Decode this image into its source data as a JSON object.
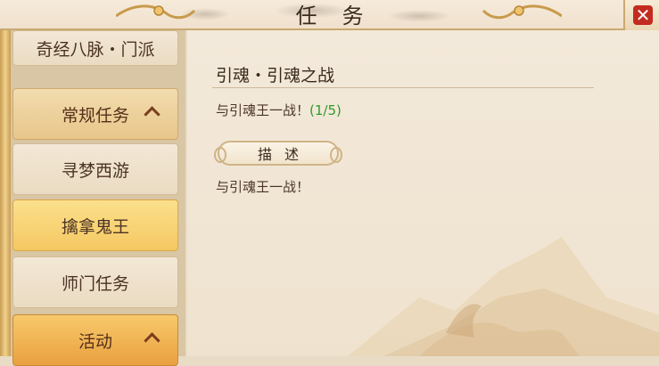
{
  "header": {
    "title": "任务"
  },
  "sidebar": {
    "items": [
      {
        "label": "奇经八脉・门派",
        "kind": "plain"
      },
      {
        "label": "常规任务",
        "kind": "category",
        "expanded": true
      },
      {
        "label": "寻梦西游",
        "kind": "plain"
      },
      {
        "label": "擒拿鬼王",
        "kind": "active"
      },
      {
        "label": "师门任务",
        "kind": "plain"
      },
      {
        "label": "活动",
        "kind": "category",
        "expanded": true
      }
    ]
  },
  "quest": {
    "title": "引魂・引魂之战",
    "objective": "与引魂王一战！",
    "progress": "(1/5)",
    "description_button": "描述",
    "description": "与引魂王一战！"
  },
  "colors": {
    "accent": "#f5c862",
    "category": "#eaa040",
    "progress": "#2f9a2a",
    "close": "#c42b20"
  }
}
